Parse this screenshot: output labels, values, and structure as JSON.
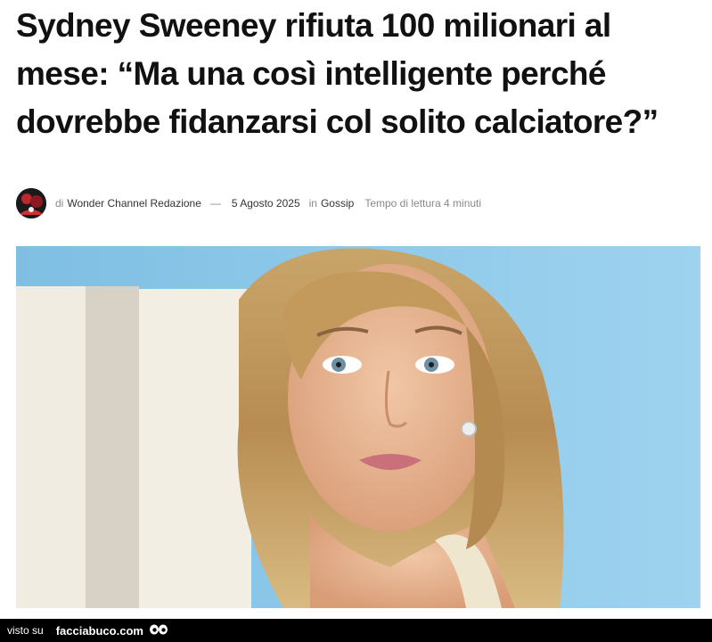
{
  "article": {
    "headline": "Sydney Sweeney rifiuta 100 milionari al mese: “Ma una così intelligente perché dovrebbe fidanzarsi col solito calciatore?”"
  },
  "byline": {
    "prefix": "di",
    "author": "Wonder Channel Redazione",
    "separator": "—",
    "date": "5 Agosto 2025",
    "in_label": "in",
    "category": "Gossip",
    "read_time": "Tempo di lettura 4 minuti"
  },
  "hero_image": {
    "icon": "portrait-photo",
    "background_color": "#8fc9e8"
  },
  "footer": {
    "visto_su": "visto su",
    "brand": "facciabuco.com",
    "logo_icon": "eyes-icon"
  }
}
